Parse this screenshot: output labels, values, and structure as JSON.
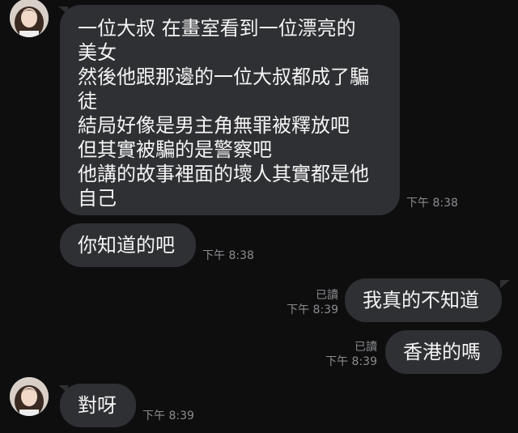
{
  "messages": [
    {
      "id": "m1",
      "direction": "incoming",
      "lines": [
        "一位大叔 在畫室看到一位漂亮的",
        "美女",
        "然後他跟那邊的一位大叔都成了騙",
        "徒",
        "結局好像是男主角無罪被釋放吧",
        "但其實被騙的是警察吧",
        "他講的故事裡面的壞人其實都是他",
        "自己"
      ],
      "time": "下午 8:38"
    },
    {
      "id": "m2",
      "direction": "incoming",
      "lines": [
        "你知道的吧"
      ],
      "time": "下午 8:38"
    },
    {
      "id": "m3",
      "direction": "outgoing",
      "lines": [
        "我真的不知道"
      ],
      "read": "已讀",
      "time": "下午 8:39"
    },
    {
      "id": "m4",
      "direction": "outgoing",
      "lines": [
        "香港的嗎"
      ],
      "read": "已讀",
      "time": "下午 8:39"
    },
    {
      "id": "m5",
      "direction": "incoming",
      "lines": [
        "對呀"
      ],
      "time": "下午 8:39"
    }
  ],
  "icons": {
    "avatar": "contact-avatar-icon"
  },
  "colors": {
    "background": "#0e0e0f",
    "bubble": "#2f3033",
    "text": "#f4f4f4",
    "meta": "#8b8c8f"
  }
}
